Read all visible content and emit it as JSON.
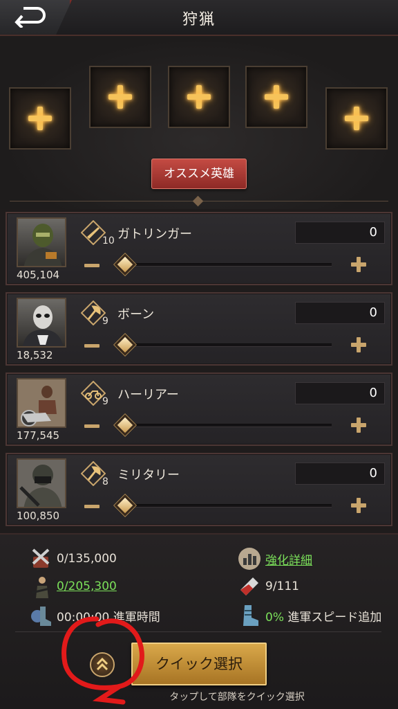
{
  "header": {
    "title": "狩猟"
  },
  "heroes": {
    "recommend_label": "オススメ英雄"
  },
  "units": [
    {
      "name": "ガトリンガー",
      "level": "10",
      "power": "405,104",
      "count": "0",
      "type_icon": "rifle-icon"
    },
    {
      "name": "ボーン",
      "level": "9",
      "power": "18,532",
      "count": "0",
      "type_icon": "axe-icon"
    },
    {
      "name": "ハーリアー",
      "level": "9",
      "power": "177,545",
      "count": "0",
      "type_icon": "motorcycle-icon"
    },
    {
      "name": "ミリタリー",
      "level": "8",
      "power": "100,850",
      "count": "0",
      "type_icon": "axe-icon"
    }
  ],
  "slider_fraction": [
    0,
    0,
    0,
    0
  ],
  "stats": {
    "load": "0/135,000",
    "troops": "0/205,300",
    "march_time": "00:00:00 進軍時間",
    "boost_detail": "強化詳細",
    "stamina": "9/111",
    "speed_pct": "0%",
    "speed_label": " 進軍スピード追加"
  },
  "quick": {
    "label": "クイック選択",
    "hint": "タップして部隊をクイック選択"
  },
  "colors": {
    "accent_gold": "#d9a84a",
    "link_green": "#7be05a",
    "recommend_red": "#c44b43"
  }
}
